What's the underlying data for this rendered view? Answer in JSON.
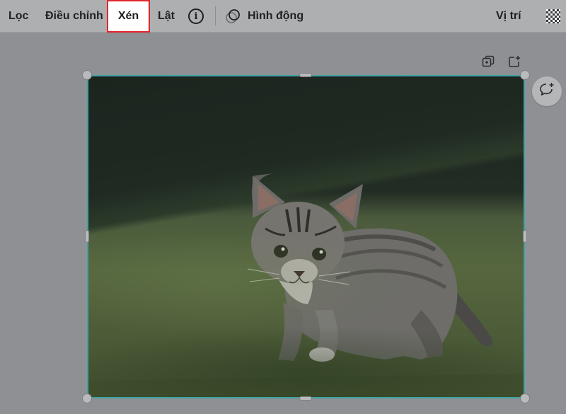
{
  "toolbar": {
    "filter_label": "Lọc",
    "adjust_label": "Điều chỉnh",
    "crop_label": "Xén",
    "flip_label": "Lật",
    "info_icon": "i",
    "animate_label": "Hình động",
    "position_label": "Vị trí"
  },
  "colors": {
    "highlight_border": "#e4252a",
    "selection_border": "#3fa3a5",
    "toolbar_bg": "#aeafb1",
    "canvas_bg": "#8e9093"
  },
  "icons": {
    "transparency": "checkerboard-icon",
    "duplicate": "duplicate-page-icon",
    "add_page": "add-page-icon",
    "comment": "add-comment-icon",
    "animate": "animate-icon"
  },
  "image": {
    "subject": "kitten"
  }
}
